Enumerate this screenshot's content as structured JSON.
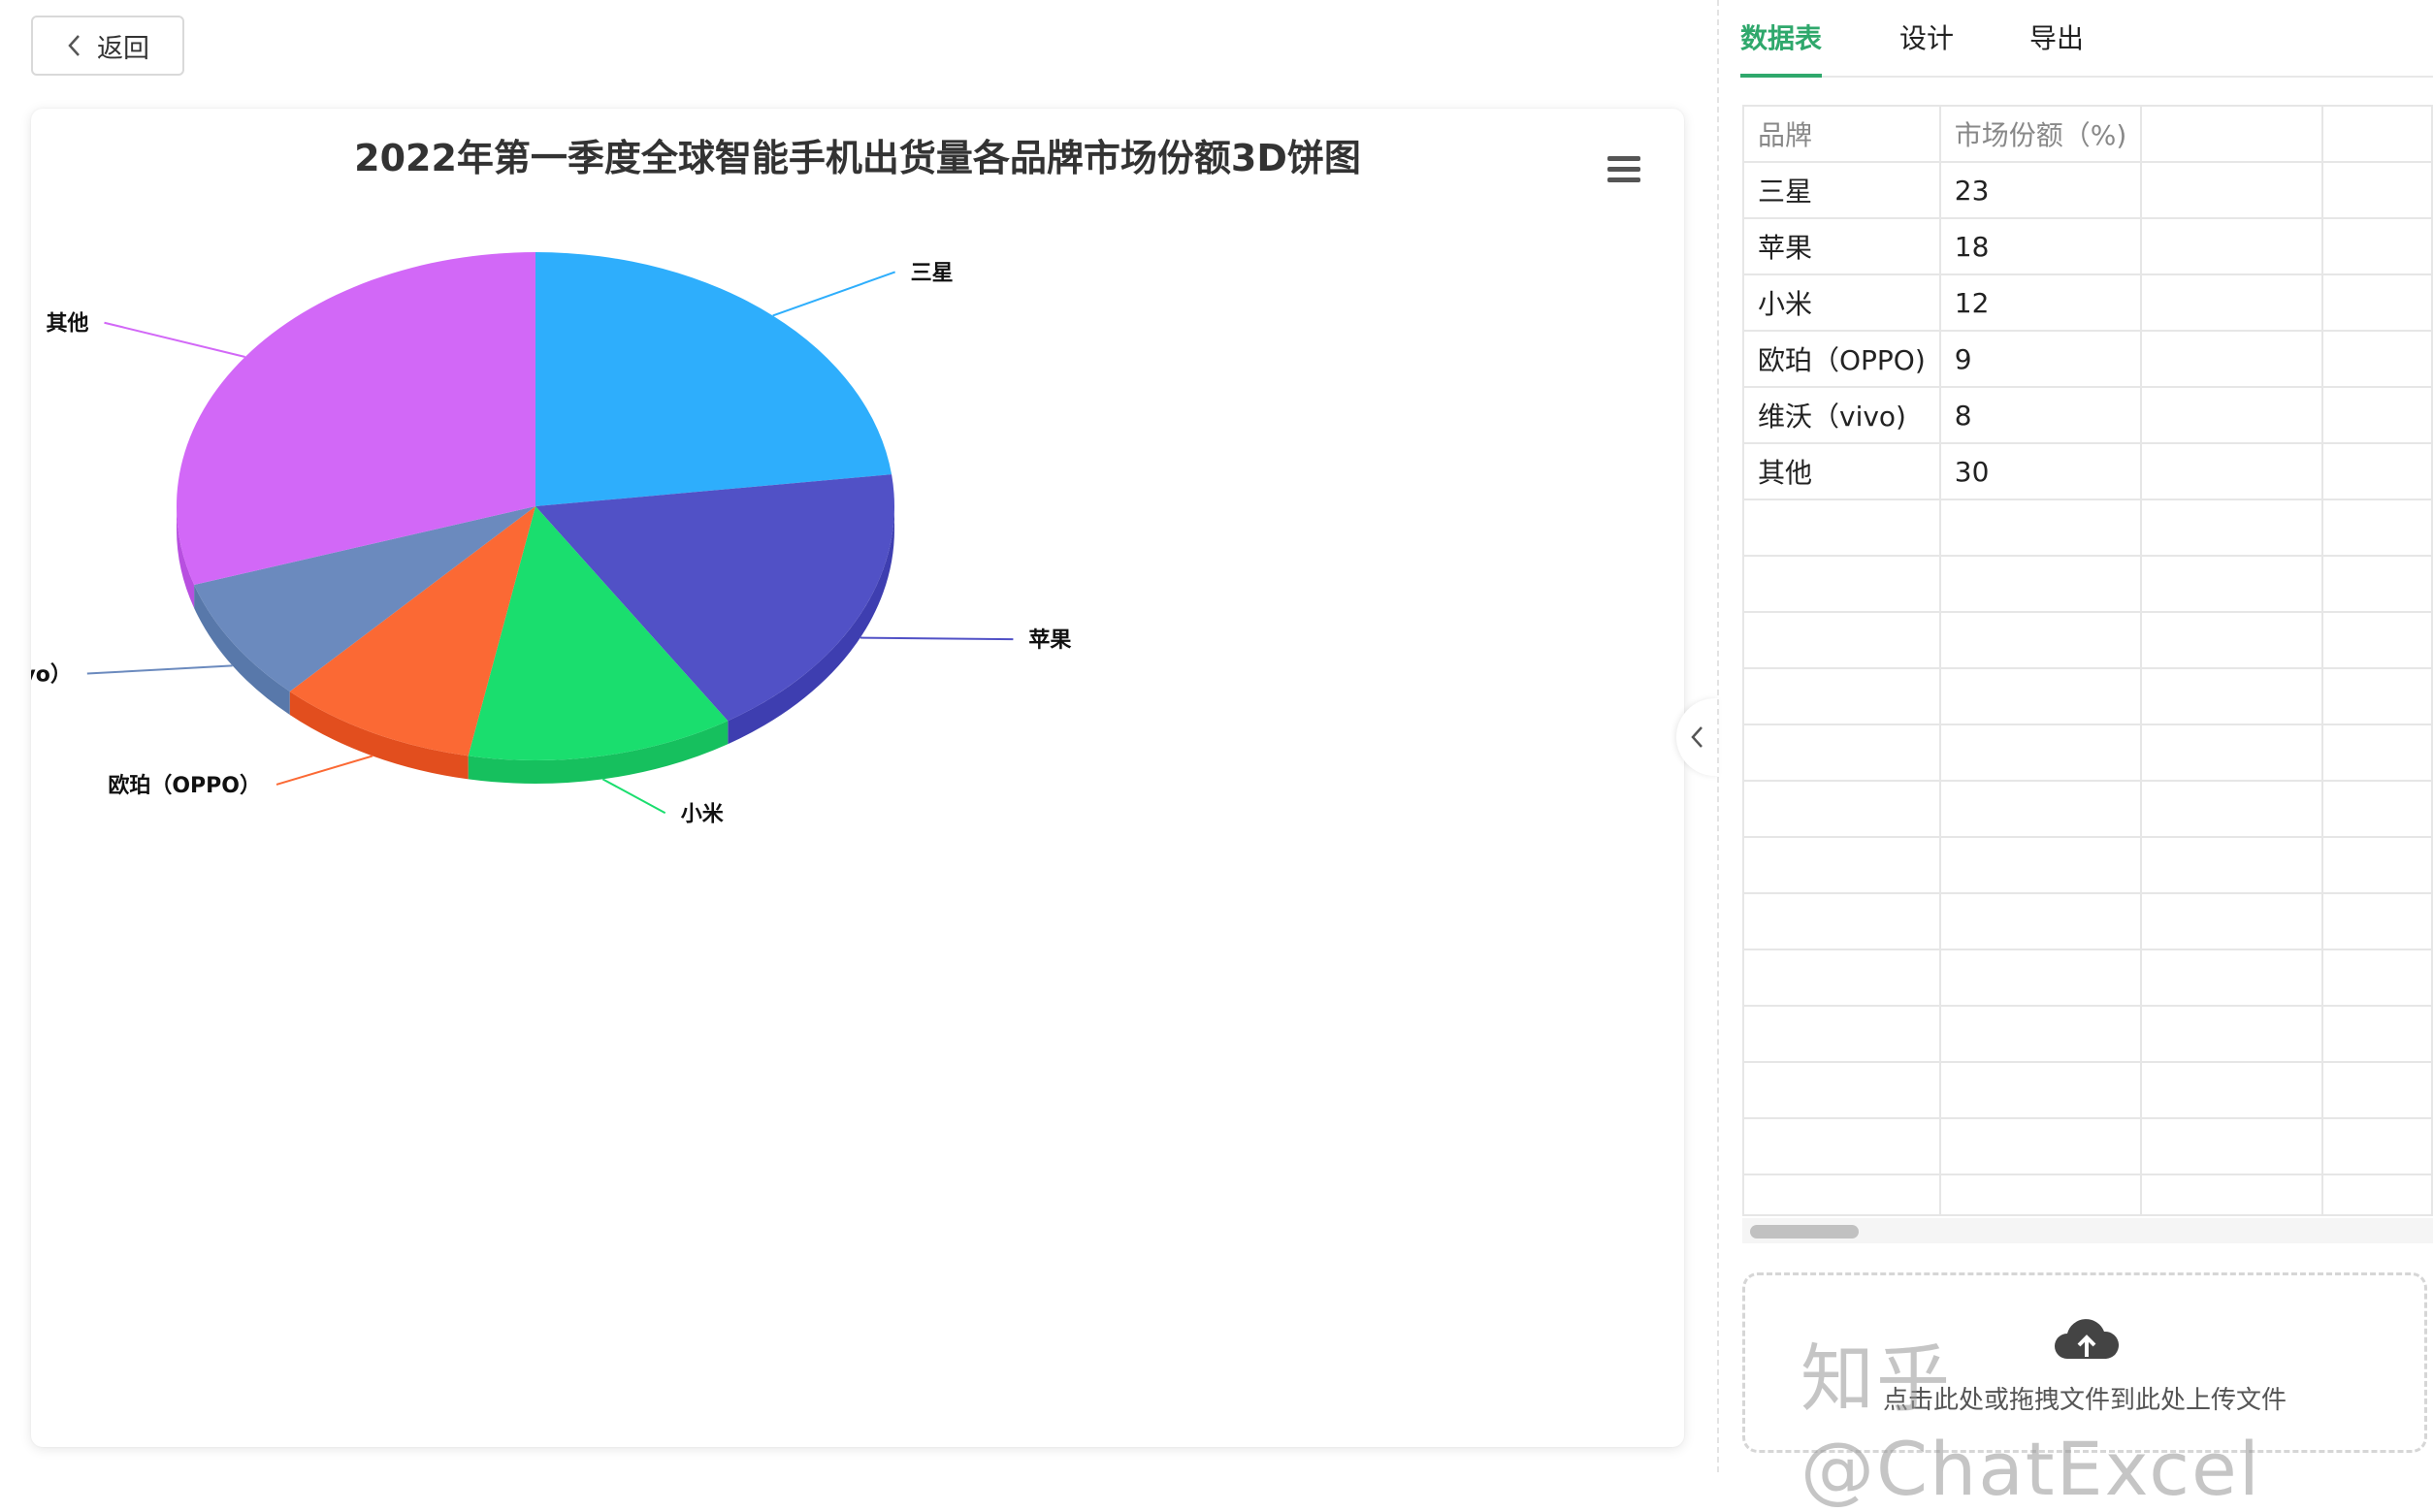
{
  "header": {
    "back_label": "返回"
  },
  "tabs": [
    {
      "label": "数据表",
      "active": true
    },
    {
      "label": "设计",
      "active": false
    },
    {
      "label": "导出",
      "active": false
    }
  ],
  "table": {
    "columns": [
      "品牌",
      "市场份额（%)"
    ],
    "rows": [
      [
        "三星",
        "23"
      ],
      [
        "苹果",
        "18"
      ],
      [
        "小米",
        "12"
      ],
      [
        "欧珀（OPPO)",
        "9"
      ],
      [
        "维沃（vivo)",
        "8"
      ],
      [
        "其他",
        "30"
      ]
    ]
  },
  "upload": {
    "text": "点击此处或拖拽文件到此处上传文件",
    "icon": "cloud-upload-icon"
  },
  "watermark": "知乎 @ChatExcel",
  "chart_data": {
    "type": "pie",
    "title": "2022年第一季度全球智能手机出货量各品牌市场份额3D饼图",
    "labels": [
      "三星",
      "苹果",
      "小米",
      "欧珀（OPPO）",
      "维沃（vivo）",
      "其他"
    ],
    "values": [
      23,
      18,
      12,
      9,
      8,
      30
    ],
    "colors": [
      "#2eaefc",
      "#5151c6",
      "#1ade6e",
      "#fb6934",
      "#6b8abe",
      "#d268f7"
    ],
    "side_colors": [
      "#2490d4",
      "#3e3eb0",
      "#16c05e",
      "#e24e1e",
      "#5878aa",
      "#b84fe0"
    ],
    "is_3d": true
  }
}
